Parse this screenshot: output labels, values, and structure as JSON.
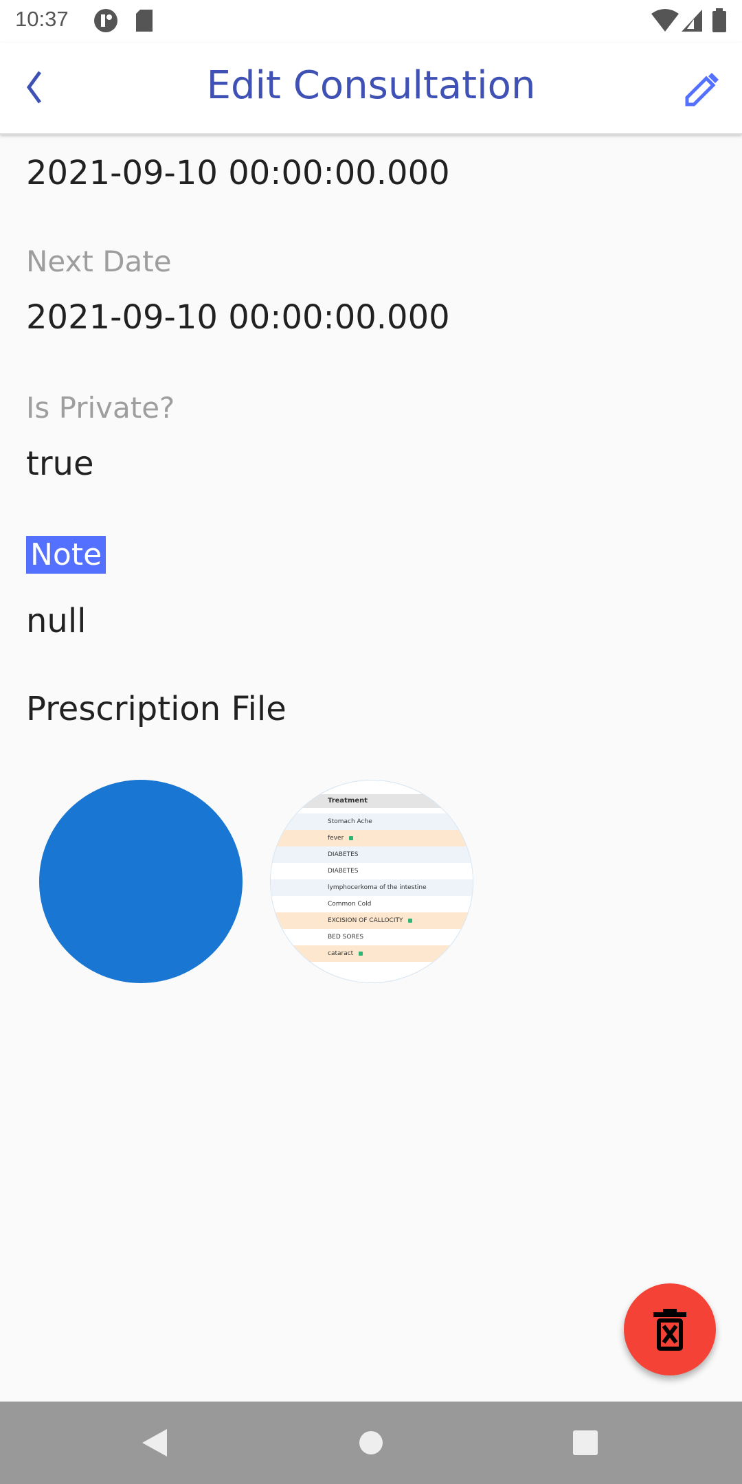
{
  "status_bar": {
    "time": "10:37"
  },
  "app_bar": {
    "title": "Edit Consultation"
  },
  "fields": {
    "date_value": "2021-09-10 00:00:00.000",
    "next_date_label": "Next Date",
    "next_date_value": "2021-09-10 00:00:00.000",
    "is_private_label": "Is Private?",
    "is_private_value": "true",
    "note_label": "Note",
    "note_value": "null"
  },
  "prescription": {
    "title": "Prescription File",
    "thumbnail_colors": {
      "blue": "#1976d2"
    },
    "preview": {
      "header": "Treatment",
      "rows": [
        {
          "text": "Stomach Ache",
          "locked": false,
          "bg": "#eef3f9"
        },
        {
          "text": "fever",
          "locked": true,
          "bg": "#fde8cf"
        },
        {
          "text": "DIABETES",
          "locked": false,
          "bg": "#eef3f9"
        },
        {
          "text": "DIABETES",
          "locked": false,
          "bg": "#ffffff"
        },
        {
          "text": "lymphocerkoma of the intestine",
          "locked": false,
          "bg": "#eef3f9"
        },
        {
          "text": "Common Cold",
          "locked": false,
          "bg": "#ffffff"
        },
        {
          "text": "EXCISION OF CALLOCITY",
          "locked": true,
          "bg": "#fde8cf"
        },
        {
          "text": "BED SORES",
          "locked": false,
          "bg": "#ffffff"
        },
        {
          "text": "cataract",
          "locked": true,
          "bg": "#fde8cf"
        }
      ]
    }
  },
  "fab": {
    "icon": "delete-forever-icon",
    "color": "#f44336"
  },
  "colors": {
    "accent": "#3f51b5",
    "highlight": "#5470ff"
  }
}
